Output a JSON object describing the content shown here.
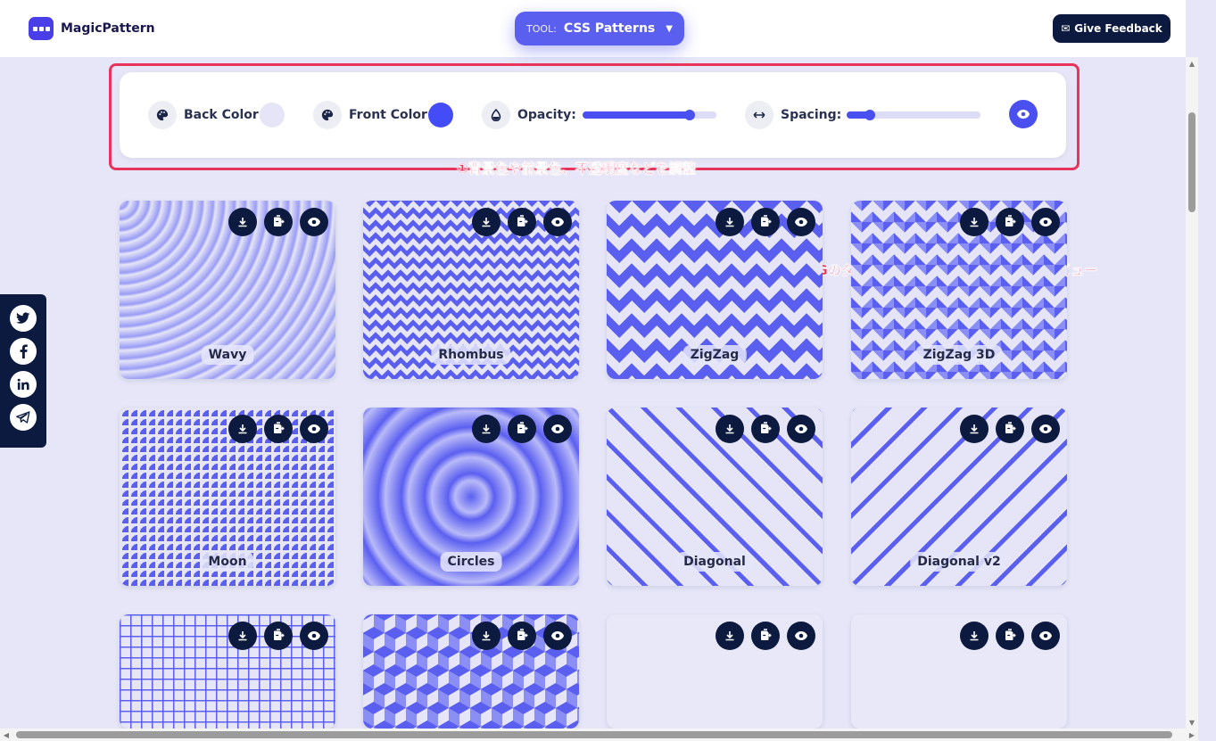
{
  "header": {
    "logo_text": "MagicPattern",
    "tool_prefix": "TOOL:",
    "tool_value": "CSS Patterns",
    "feedback_label": "Give Feedback"
  },
  "controls": {
    "back_color_label": "Back Color:",
    "back_color_value": "#e5e5f7",
    "front_color_label": "Front Color:",
    "front_color_value": "#444cf7",
    "opacity_label": "Opacity:",
    "opacity_value": 0.8,
    "spacing_label": "Spacing:",
    "spacing_value": 0.17
  },
  "annotations": {
    "settings_note": "①背景色や前景色、不透明度などを調整",
    "actions_arrow": "↑",
    "actions_note": "PNGのダウンロード／CSSのコピー／プレビュー"
  },
  "patterns": [
    {
      "name": "Wavy",
      "style": "p-wavy"
    },
    {
      "name": "Rhombus",
      "style": "p-rhombus"
    },
    {
      "name": "ZigZag",
      "style": "p-zigzag"
    },
    {
      "name": "ZigZag 3D",
      "style": "p-zigzag3d"
    },
    {
      "name": "Moon",
      "style": "p-moon"
    },
    {
      "name": "Circles",
      "style": "p-circles"
    },
    {
      "name": "Diagonal",
      "style": "p-diagonal"
    },
    {
      "name": "Diagonal v2",
      "style": "p-diagonal2"
    },
    {
      "name": "",
      "style": "p-grid"
    },
    {
      "name": "",
      "style": "p-cubes"
    },
    {
      "name": "",
      "style": "p-blank"
    },
    {
      "name": "",
      "style": "p-blank"
    }
  ],
  "card_actions": [
    "download-icon",
    "copy-css-icon",
    "preview-eye-icon"
  ],
  "social": [
    "twitter-icon",
    "facebook-icon",
    "linkedin-icon",
    "telegram-icon"
  ],
  "colors": {
    "accent": "#5b5ff0",
    "dark": "#0d1a3f",
    "annotation": "#e8345a",
    "page_bg": "#e6e6f8"
  }
}
